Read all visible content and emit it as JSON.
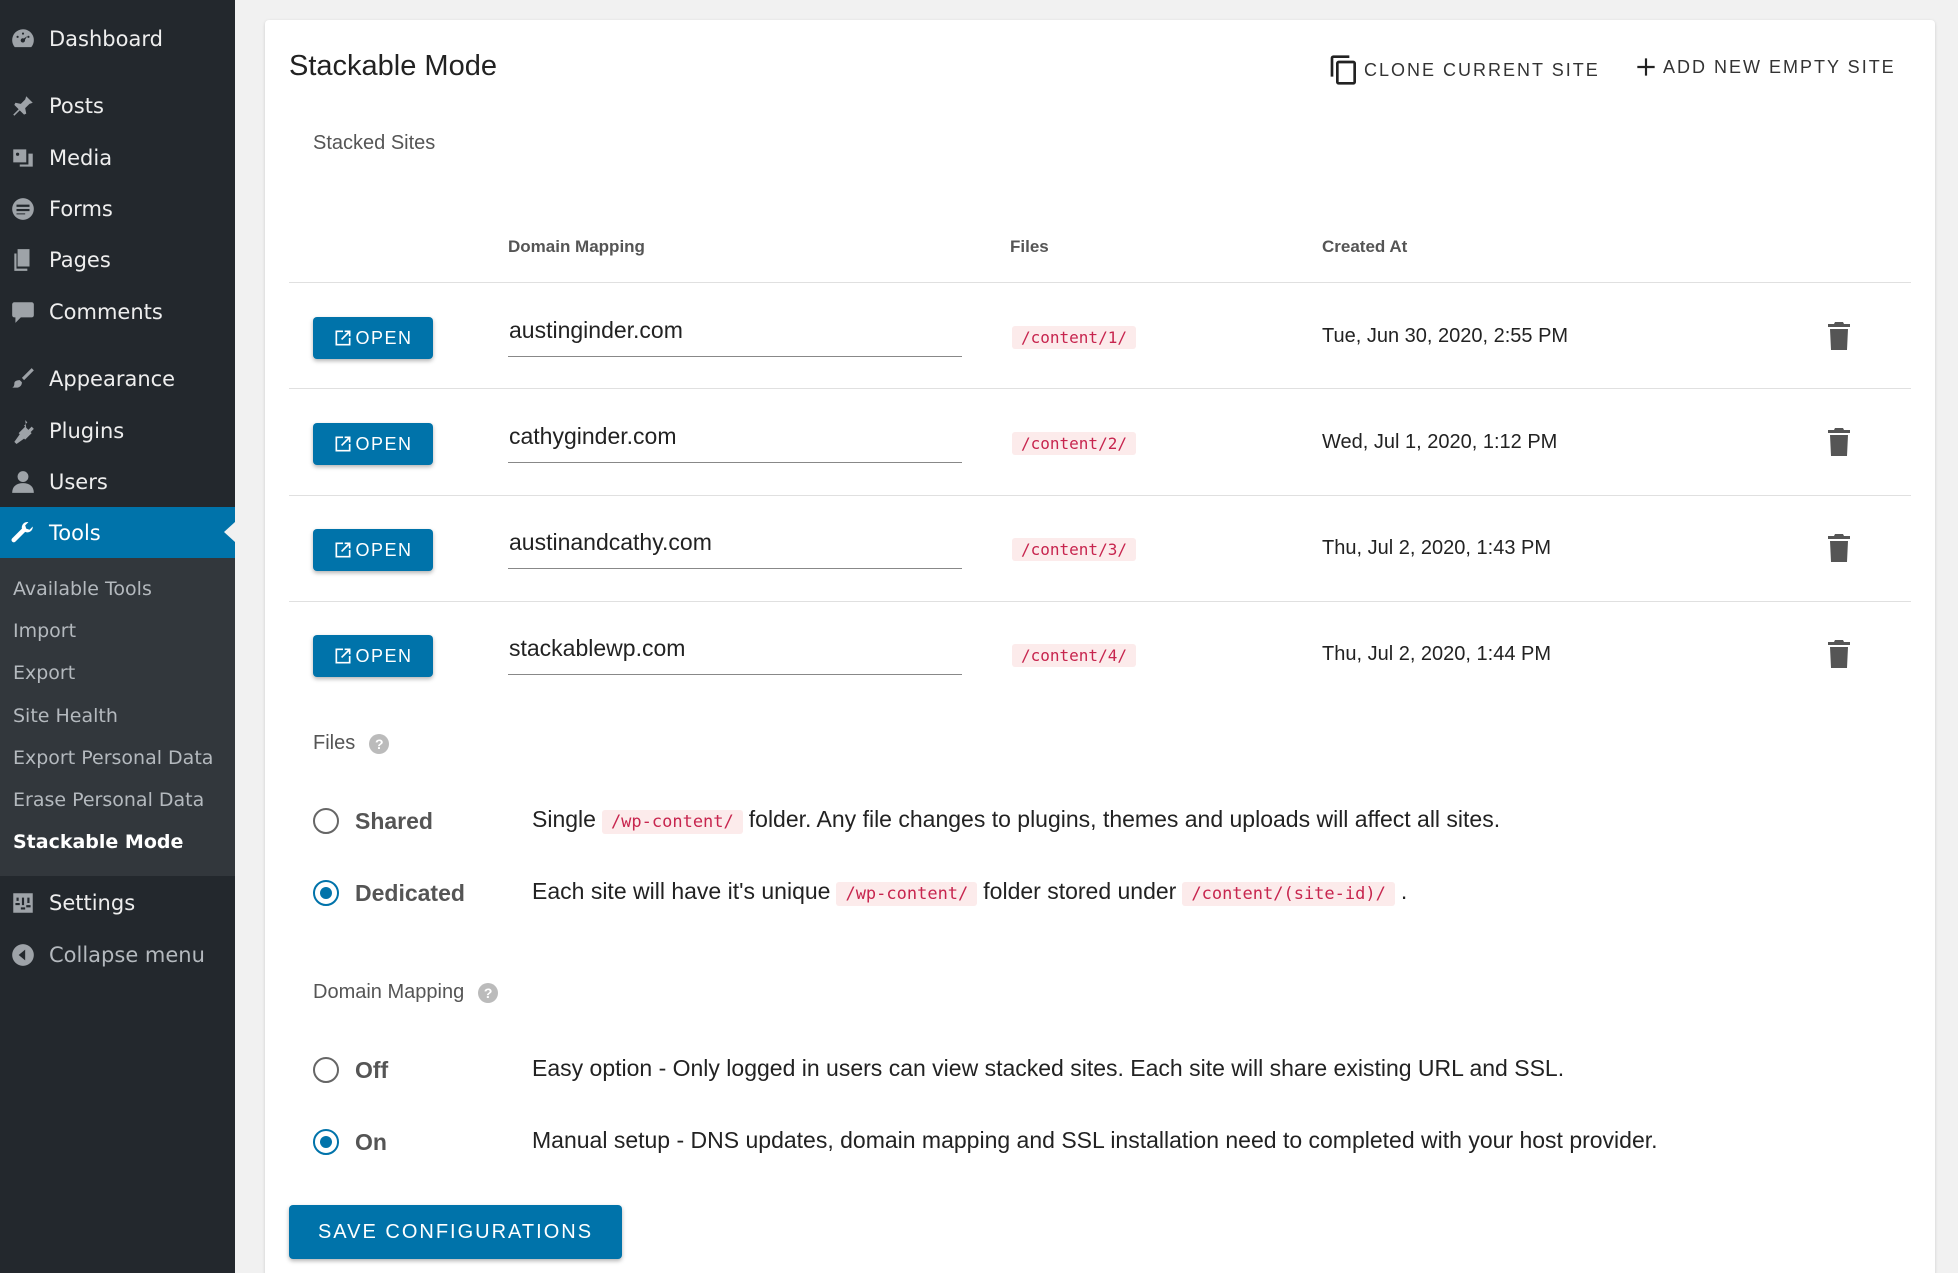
{
  "sidebar": {
    "items": [
      {
        "label": "Dashboard",
        "icon": "dashboard-icon"
      },
      {
        "label": "Posts",
        "icon": "pin-icon"
      },
      {
        "label": "Media",
        "icon": "media-icon"
      },
      {
        "label": "Forms",
        "icon": "forms-icon"
      },
      {
        "label": "Pages",
        "icon": "pages-icon"
      },
      {
        "label": "Comments",
        "icon": "comment-icon"
      },
      {
        "label": "Appearance",
        "icon": "paintbrush-icon"
      },
      {
        "label": "Plugins",
        "icon": "plugin-icon"
      },
      {
        "label": "Users",
        "icon": "user-icon"
      },
      {
        "label": "Tools",
        "icon": "wrench-icon"
      },
      {
        "label": "Settings",
        "icon": "settings-icon"
      },
      {
        "label": "Collapse menu",
        "icon": "collapse-icon"
      }
    ],
    "submenu": [
      "Available Tools",
      "Import",
      "Export",
      "Site Health",
      "Export Personal Data",
      "Erase Personal Data",
      "Stackable Mode"
    ]
  },
  "page": {
    "title": "Stackable Mode",
    "clone_label": "CLONE CURRENT SITE",
    "add_label": "ADD NEW EMPTY SITE"
  },
  "stacked": {
    "section_label": "Stacked Sites",
    "headers": {
      "domain": "Domain Mapping",
      "files": "Files",
      "created": "Created At"
    },
    "open_label": "OPEN",
    "rows": [
      {
        "domain": "austinginder.com",
        "files": "/content/1/",
        "created": "Tue, Jun 30, 2020, 2:55 PM"
      },
      {
        "domain": "cathyginder.com",
        "files": "/content/2/",
        "created": "Wed, Jul 1, 2020, 1:12 PM"
      },
      {
        "domain": "austinandcathy.com",
        "files": "/content/3/",
        "created": "Thu, Jul 2, 2020, 1:43 PM"
      },
      {
        "domain": "stackablewp.com",
        "files": "/content/4/",
        "created": "Thu, Jul 2, 2020, 1:44 PM"
      }
    ]
  },
  "files": {
    "label": "Files",
    "help": "?",
    "shared": {
      "label": "Shared",
      "desc_a": "Single",
      "code": "/wp-content/",
      "desc_b": "folder. Any file changes to plugins, themes and uploads will affect all sites."
    },
    "dedicated": {
      "label": "Dedicated",
      "desc_a": "Each site will have it's unique",
      "code_a": "/wp-content/",
      "desc_b": "folder stored under",
      "code_b": "/content/(site-id)/",
      "desc_c": "."
    },
    "selected": "Dedicated"
  },
  "domain_mapping": {
    "label": "Domain Mapping",
    "help": "?",
    "off": {
      "label": "Off",
      "desc": "Easy option - Only logged in users can view stacked sites. Each site will share existing URL and SSL."
    },
    "on": {
      "label": "On",
      "desc": "Manual setup - DNS updates, domain mapping and SSL installation need to completed with your host provider."
    },
    "selected": "On"
  },
  "save_label": "SAVE CONFIGURATIONS",
  "colors": {
    "accent": "#0073aa",
    "sidebar": "#23282d",
    "code_text": "#c7254e"
  }
}
